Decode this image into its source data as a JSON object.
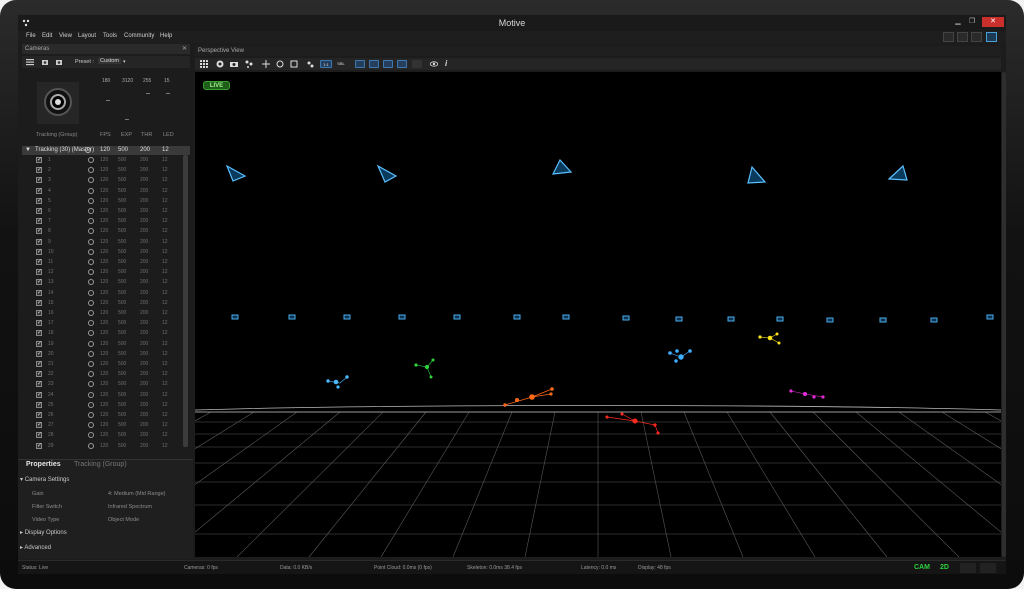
{
  "window": {
    "title": "Motive"
  },
  "window_controls": {
    "minimize": "▁",
    "maximize": "❐",
    "close": "✕"
  },
  "menu": [
    "File",
    "Edit",
    "View",
    "Layout",
    "Tools",
    "Community",
    "Help"
  ],
  "cameras_panel": {
    "title": "Cameras",
    "close_glyph": "✕",
    "preset_label": "Preset :",
    "preset_value": "Custom",
    "column_values": {
      "fps": "180",
      "exp": "3120",
      "thr": "255",
      "led": "15"
    },
    "column_labels": {
      "fps": "FPS",
      "exp": "EXP",
      "thr": "THR",
      "led": "LED"
    },
    "group_name": "Tracking (Group)",
    "group_header": {
      "label": "Tracking (30) (Master)",
      "fps": "120",
      "exp": "500",
      "thr": "200",
      "led": "12"
    },
    "rows": [
      {
        "id": "1"
      },
      {
        "id": "2"
      },
      {
        "id": "3"
      },
      {
        "id": "4"
      },
      {
        "id": "5"
      },
      {
        "id": "6"
      },
      {
        "id": "7"
      },
      {
        "id": "8"
      },
      {
        "id": "9"
      },
      {
        "id": "10"
      },
      {
        "id": "11"
      },
      {
        "id": "12"
      },
      {
        "id": "13"
      },
      {
        "id": "14"
      },
      {
        "id": "15"
      },
      {
        "id": "16"
      },
      {
        "id": "17"
      },
      {
        "id": "18"
      },
      {
        "id": "19"
      },
      {
        "id": "20"
      },
      {
        "id": "21"
      },
      {
        "id": "22"
      },
      {
        "id": "23"
      },
      {
        "id": "24"
      },
      {
        "id": "25"
      },
      {
        "id": "26"
      },
      {
        "id": "27"
      },
      {
        "id": "28"
      },
      {
        "id": "29"
      }
    ],
    "row_values": {
      "fps": "120",
      "exp": "500",
      "thr": "200",
      "led": "12"
    }
  },
  "properties": {
    "tab_properties": "Properties",
    "tab_group": "Tracking (Group)",
    "camera_settings": "Camera Settings",
    "gain_label": "Gain",
    "gain_value": "4: Medium (Mid Range)",
    "filter_label": "Filter Switch",
    "filter_value": "Infrared Spectrum",
    "video_label": "Video Type",
    "video_value": "Object Mode",
    "display_options": "Display Options",
    "advanced": "Advanced"
  },
  "viewport": {
    "title": "Perspective View",
    "live_label": "LIVE",
    "btn_a": "1:1",
    "btn_b": "SBL",
    "info_glyph": "i"
  },
  "status": {
    "status": "Status: Live",
    "cameras": "Cameras: 0 fps",
    "data": "Data: 0.0 KB/s",
    "point_cloud": "Point Cloud: 0.0ms (0 fps)",
    "skeleton": "Skeleton: 0.0ms 38.4 fps",
    "latency": "Latency: 0.0 ms",
    "display": "Display: 48 fps",
    "cam_mode": "CAM",
    "view_mode": "2D"
  },
  "colors": {
    "accent_blue": "#3fb0ff",
    "live_green": "#3aa12f",
    "close_red": "#c9302c"
  }
}
